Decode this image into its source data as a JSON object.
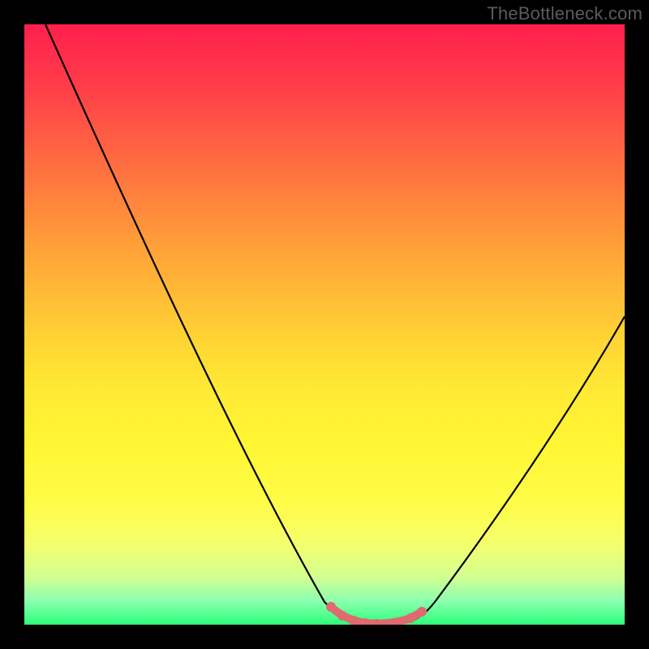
{
  "watermark": "TheBottleneck.com",
  "chart_data": {
    "type": "line",
    "title": "",
    "xlabel": "",
    "ylabel": "",
    "x": [
      0.0,
      0.05,
      0.1,
      0.15,
      0.2,
      0.25,
      0.3,
      0.35,
      0.4,
      0.45,
      0.5,
      0.52,
      0.55,
      0.58,
      0.6,
      0.62,
      0.65,
      0.68,
      0.72,
      0.78,
      0.84,
      0.9,
      0.95,
      1.0
    ],
    "y": [
      1.0,
      0.9,
      0.8,
      0.7,
      0.6,
      0.5,
      0.4,
      0.31,
      0.22,
      0.13,
      0.05,
      0.02,
      0.0,
      0.0,
      0.0,
      0.0,
      0.0,
      0.02,
      0.06,
      0.14,
      0.24,
      0.35,
      0.44,
      0.52
    ],
    "xlim": [
      0,
      1
    ],
    "ylim": [
      0,
      1
    ],
    "marker_points_x": [
      0.51,
      0.53,
      0.55,
      0.57,
      0.59,
      0.61,
      0.63,
      0.65,
      0.67
    ],
    "marker_points_y": [
      0.03,
      0.015,
      0.005,
      0.0,
      0.0,
      0.0,
      0.005,
      0.01,
      0.02
    ],
    "colors": {
      "curve": "#000000",
      "markers": "#e06a6f",
      "gradient_top": "#ff204c",
      "gradient_bottom": "#2cff7a"
    }
  }
}
